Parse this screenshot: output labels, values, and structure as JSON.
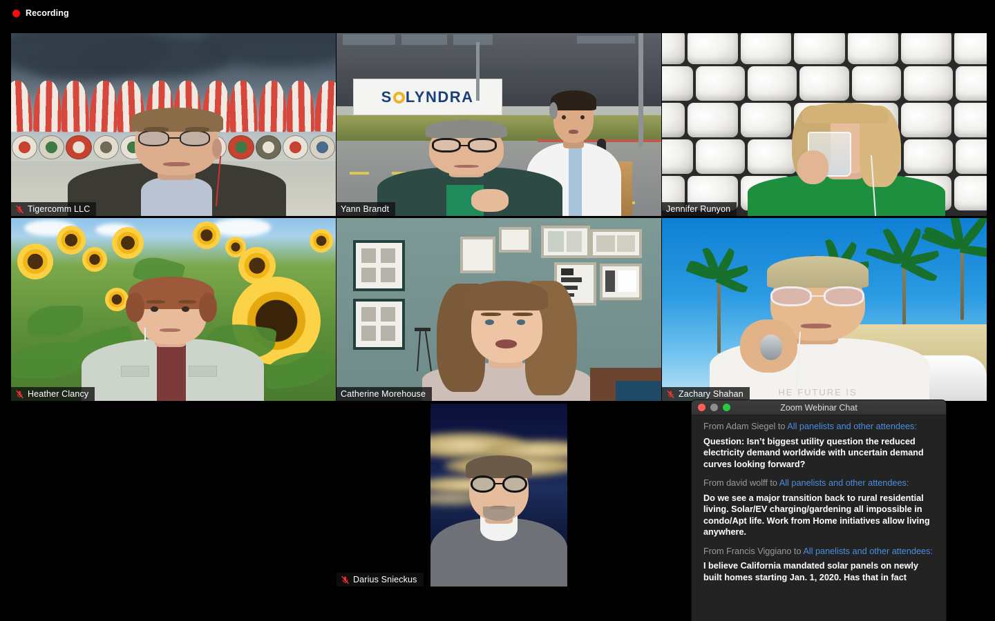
{
  "recording": {
    "label": "Recording",
    "dot_color": "#f50f0f"
  },
  "meeting": {
    "active_speaker_color": "#c8f53c",
    "participants": [
      {
        "name": "Tigercomm LLC",
        "muted": true,
        "speaking": false,
        "background": "viking-ships-virtual-background"
      },
      {
        "name": "Yann Brandt",
        "muted": false,
        "speaking": false,
        "background": "solyndra-sign-virtual-background"
      },
      {
        "name": "Jennifer Runyon",
        "muted": false,
        "speaking": false,
        "background": "toilet-paper-wall-virtual-background"
      },
      {
        "name": "Heather Clancy",
        "muted": true,
        "speaking": false,
        "background": "sunflower-field-virtual-background"
      },
      {
        "name": "Catherine Morehouse",
        "muted": false,
        "speaking": true,
        "background": "picture-frame-wall"
      },
      {
        "name": "Zachary Shahan",
        "muted": true,
        "speaking": false,
        "background": "palm-trees-virtual-background"
      },
      {
        "name": "Darius Snieckus",
        "muted": true,
        "speaking": false,
        "background": "stormy-sky-virtual-background"
      }
    ]
  },
  "signage": {
    "solyndra": "SOLYNDRA"
  },
  "tshirt": {
    "zachary": "HE FUTURE IS"
  },
  "chat": {
    "window_title": "Zoom Webinar Chat",
    "traffic_lights": {
      "close": "#ff5f57",
      "minimize": "#8d8d8d",
      "zoom": "#28c840"
    },
    "link_color": "#4a8ee0",
    "messages": [
      {
        "from_prefix": "From Adam Siegel to ",
        "to": "All panelists and other attendees:",
        "text": "Question:  Isn’t biggest utility question the reduced electricity demand worldwide with uncertain demand curves looking forward?"
      },
      {
        "from_prefix": "From david wolff to ",
        "to": "All panelists and other attendees:",
        "text": "Do we see a major transition back to rural residential living.  Solar/EV charging/gardening all impossible in condo/Apt life.  Work from Home initiatives allow living anywhere."
      },
      {
        "from_prefix": "From Francis Viggiano to ",
        "to": "All panelists and other attendees:",
        "text": "I believe California mandated solar panels on newly built homes starting Jan. 1, 2020.  Has that in fact"
      }
    ]
  }
}
